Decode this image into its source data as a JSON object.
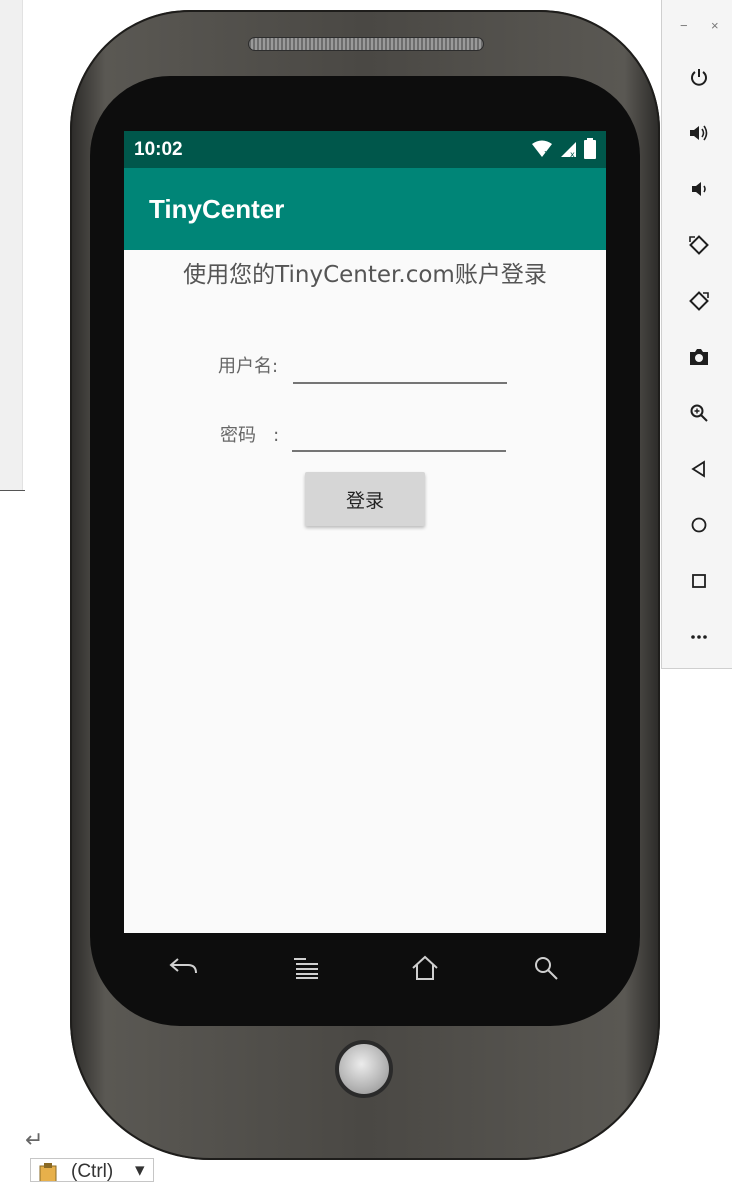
{
  "device": {
    "status_bar": {
      "time": "10:02"
    },
    "app_bar": {
      "title": "TinyCenter"
    },
    "screen": {
      "heading": "使用您的TinyCenter.com账户登录",
      "username_label": "用户名:",
      "username_value": "",
      "password_label": "密码   :",
      "password_value": "",
      "login_button": "登录"
    },
    "nav_bar": {
      "icons": [
        "back-icon",
        "menu-icon",
        "home-icon",
        "search-icon"
      ]
    }
  },
  "emulator_toolbar": {
    "window_controls": {
      "minimize": "−",
      "close": "×"
    },
    "tools": [
      "power-icon",
      "volume-up-icon",
      "volume-down-icon",
      "rotate-left-icon",
      "rotate-right-icon",
      "camera-icon",
      "zoom-icon",
      "back-icon",
      "home-icon",
      "overview-icon",
      "more-icon"
    ]
  },
  "desktop": {
    "paste_chip_label": "(Ctrl)"
  },
  "colors": {
    "status_bar": "#00574b",
    "app_bar": "#008577",
    "screen_bg": "#fafafa"
  }
}
